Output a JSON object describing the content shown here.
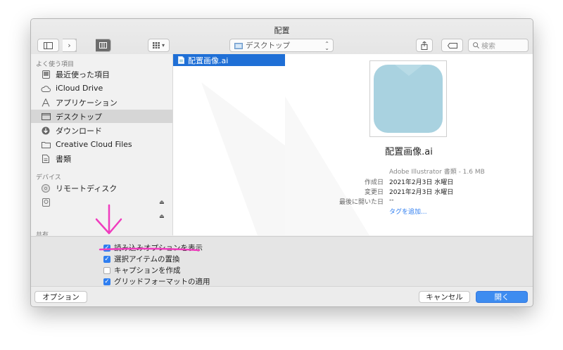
{
  "window": {
    "title": "配置"
  },
  "toolbar": {
    "location_label": "デスクトップ",
    "search_placeholder": "検索"
  },
  "sidebar": {
    "favorites_header": "よく使う項目",
    "favorites": [
      {
        "label": "最近使った項目",
        "icon": "recents-icon"
      },
      {
        "label": "iCloud Drive",
        "icon": "cloud-icon"
      },
      {
        "label": "アプリケーション",
        "icon": "applications-icon"
      },
      {
        "label": "デスクトップ",
        "icon": "desktop-icon",
        "selected": true
      },
      {
        "label": "ダウンロード",
        "icon": "download-icon"
      },
      {
        "label": "Creative Cloud Files",
        "icon": "folder-icon"
      },
      {
        "label": "書類",
        "icon": "documents-icon"
      }
    ],
    "devices_header": "デバイス",
    "devices": [
      {
        "label": "リモートディスク",
        "icon": "disc-icon"
      },
      {
        "label": "",
        "icon": "drive-icon"
      },
      {
        "label": "",
        "icon": "drive-icon"
      }
    ],
    "shared_header": "共有"
  },
  "files": [
    {
      "name": "配置画像.ai",
      "selected": true
    }
  ],
  "preview": {
    "filename": "配置画像.ai",
    "kind": "Adobe Illustrator 書類 - 1.6 MB",
    "created_label": "作成日",
    "created_value": "2021年2月3日 水曜日",
    "modified_label": "変更日",
    "modified_value": "2021年2月3日 水曜日",
    "opened_label": "最後に開いた日",
    "opened_value": "--",
    "add_tags": "タグを追加..."
  },
  "options": [
    {
      "label": "読み込みオプションを表示",
      "checked": true
    },
    {
      "label": "選択アイテムの置換",
      "checked": true
    },
    {
      "label": "キャプションを作成",
      "checked": false
    },
    {
      "label": "グリッドフォーマットの適用",
      "checked": true
    }
  ],
  "footer": {
    "options_button": "オプション",
    "cancel_button": "キャンセル",
    "open_button": "開く"
  },
  "colors": {
    "accent": "#2f7ef0",
    "selection": "#1f6fd6",
    "annotation": "#f03cbe",
    "thumbnail": "#a9d2e0"
  }
}
